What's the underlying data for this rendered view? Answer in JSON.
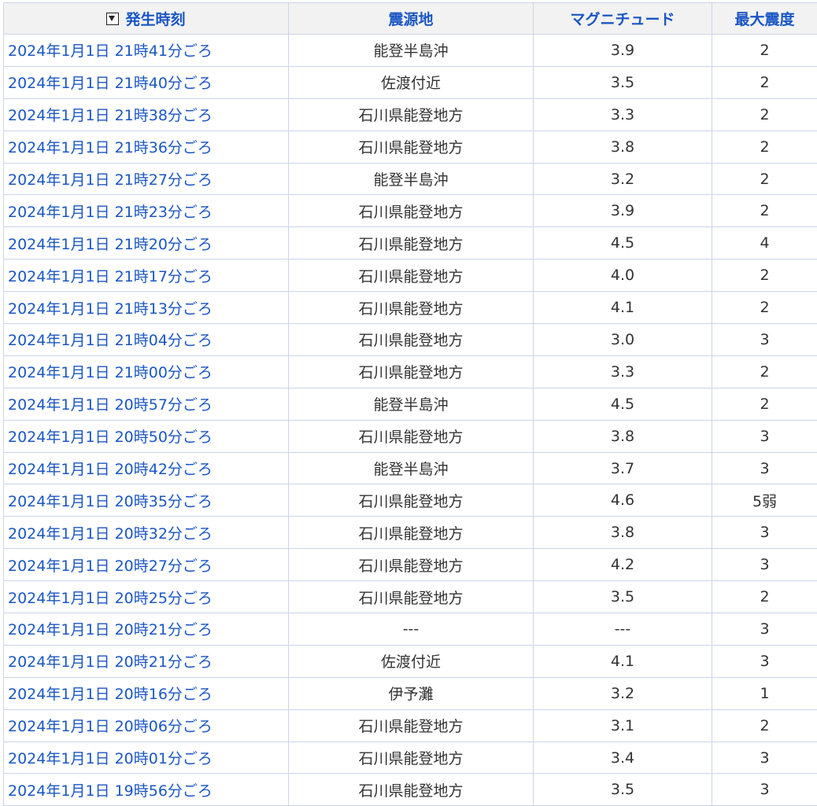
{
  "table": {
    "headers": {
      "time": "発生時刻",
      "location": "震源地",
      "magnitude": "マグニチュード",
      "intensity": "最大震度"
    },
    "sort_icon": "sort-down-icon",
    "accent_color": "#1a56c4",
    "rows": [
      {
        "time": "2024年1月1日 21時41分ごろ",
        "location": "能登半島沖",
        "magnitude": "3.9",
        "intensity": "2"
      },
      {
        "time": "2024年1月1日 21時40分ごろ",
        "location": "佐渡付近",
        "magnitude": "3.5",
        "intensity": "2"
      },
      {
        "time": "2024年1月1日 21時38分ごろ",
        "location": "石川県能登地方",
        "magnitude": "3.3",
        "intensity": "2"
      },
      {
        "time": "2024年1月1日 21時36分ごろ",
        "location": "石川県能登地方",
        "magnitude": "3.8",
        "intensity": "2"
      },
      {
        "time": "2024年1月1日 21時27分ごろ",
        "location": "能登半島沖",
        "magnitude": "3.2",
        "intensity": "2"
      },
      {
        "time": "2024年1月1日 21時23分ごろ",
        "location": "石川県能登地方",
        "magnitude": "3.9",
        "intensity": "2"
      },
      {
        "time": "2024年1月1日 21時20分ごろ",
        "location": "石川県能登地方",
        "magnitude": "4.5",
        "intensity": "4"
      },
      {
        "time": "2024年1月1日 21時17分ごろ",
        "location": "石川県能登地方",
        "magnitude": "4.0",
        "intensity": "2"
      },
      {
        "time": "2024年1月1日 21時13分ごろ",
        "location": "石川県能登地方",
        "magnitude": "4.1",
        "intensity": "2"
      },
      {
        "time": "2024年1月1日 21時04分ごろ",
        "location": "石川県能登地方",
        "magnitude": "3.0",
        "intensity": "3"
      },
      {
        "time": "2024年1月1日 21時00分ごろ",
        "location": "石川県能登地方",
        "magnitude": "3.3",
        "intensity": "2"
      },
      {
        "time": "2024年1月1日 20時57分ごろ",
        "location": "能登半島沖",
        "magnitude": "4.5",
        "intensity": "2"
      },
      {
        "time": "2024年1月1日 20時50分ごろ",
        "location": "石川県能登地方",
        "magnitude": "3.8",
        "intensity": "3"
      },
      {
        "time": "2024年1月1日 20時42分ごろ",
        "location": "能登半島沖",
        "magnitude": "3.7",
        "intensity": "3"
      },
      {
        "time": "2024年1月1日 20時35分ごろ",
        "location": "石川県能登地方",
        "magnitude": "4.6",
        "intensity": "5弱"
      },
      {
        "time": "2024年1月1日 20時32分ごろ",
        "location": "石川県能登地方",
        "magnitude": "3.8",
        "intensity": "3"
      },
      {
        "time": "2024年1月1日 20時27分ごろ",
        "location": "石川県能登地方",
        "magnitude": "4.2",
        "intensity": "3"
      },
      {
        "time": "2024年1月1日 20時25分ごろ",
        "location": "石川県能登地方",
        "magnitude": "3.5",
        "intensity": "2"
      },
      {
        "time": "2024年1月1日 20時21分ごろ",
        "location": "---",
        "magnitude": "---",
        "intensity": "3"
      },
      {
        "time": "2024年1月1日 20時21分ごろ",
        "location": "佐渡付近",
        "magnitude": "4.1",
        "intensity": "3"
      },
      {
        "time": "2024年1月1日 20時16分ごろ",
        "location": "伊予灘",
        "magnitude": "3.2",
        "intensity": "1"
      },
      {
        "time": "2024年1月1日 20時06分ごろ",
        "location": "石川県能登地方",
        "magnitude": "3.1",
        "intensity": "2"
      },
      {
        "time": "2024年1月1日 20時01分ごろ",
        "location": "石川県能登地方",
        "magnitude": "3.4",
        "intensity": "3"
      },
      {
        "time": "2024年1月1日 19時56分ごろ",
        "location": "石川県能登地方",
        "magnitude": "3.5",
        "intensity": "3"
      }
    ]
  }
}
